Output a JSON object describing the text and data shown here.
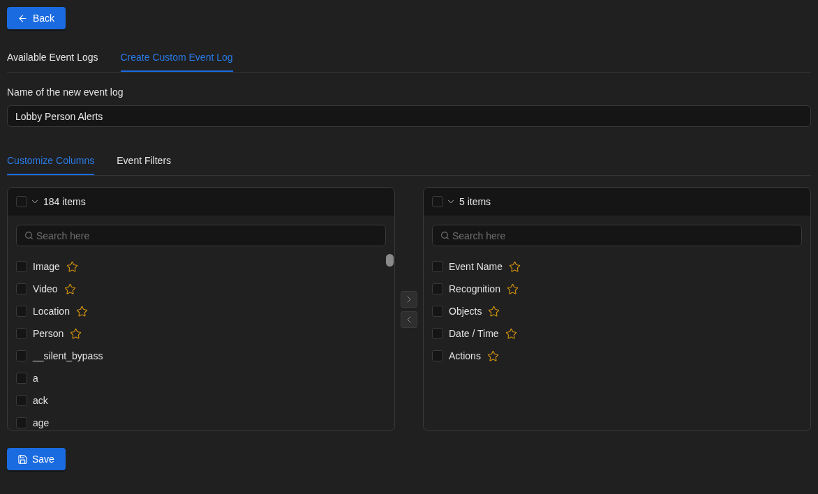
{
  "back_button": {
    "label": "Back"
  },
  "tabs": [
    {
      "label": "Available Event Logs",
      "selected": false
    },
    {
      "label": "Create Custom Event Log",
      "selected": true
    }
  ],
  "name_field": {
    "label": "Name of the new event log",
    "value": "Lobby Person Alerts"
  },
  "sub_tabs": [
    {
      "label": "Customize Columns",
      "selected": true
    },
    {
      "label": "Event Filters",
      "selected": false
    }
  ],
  "source_list": {
    "all_checked": false,
    "count": "184 items",
    "search": {
      "placeholder": "Search here"
    },
    "items": [
      {
        "label": "Image",
        "checked": false,
        "starred": true
      },
      {
        "label": "Video",
        "checked": false,
        "starred": true
      },
      {
        "label": "Location",
        "checked": false,
        "starred": true
      },
      {
        "label": "Person",
        "checked": false,
        "starred": true
      },
      {
        "label": "__silent_bypass",
        "checked": false,
        "starred": false
      },
      {
        "label": "a",
        "checked": false,
        "starred": false
      },
      {
        "label": "ack",
        "checked": false,
        "starred": false
      },
      {
        "label": "age",
        "checked": false,
        "starred": false
      }
    ]
  },
  "move_buttons": [
    {
      "kind": "right",
      "disabled": true
    },
    {
      "kind": "left",
      "disabled": true
    }
  ],
  "target_list": {
    "all_checked": false,
    "count": "5 items",
    "search": {
      "placeholder": "Search here"
    },
    "items": [
      {
        "label": "Event Name",
        "checked": false,
        "starred": true
      },
      {
        "label": "Recognition",
        "checked": false,
        "starred": true
      },
      {
        "label": "Objects",
        "checked": false,
        "starred": true
      },
      {
        "label": "Date / Time",
        "checked": false,
        "starred": true
      },
      {
        "label": "Actions",
        "checked": false,
        "starred": true
      }
    ]
  },
  "save_button": {
    "label": "Save"
  }
}
